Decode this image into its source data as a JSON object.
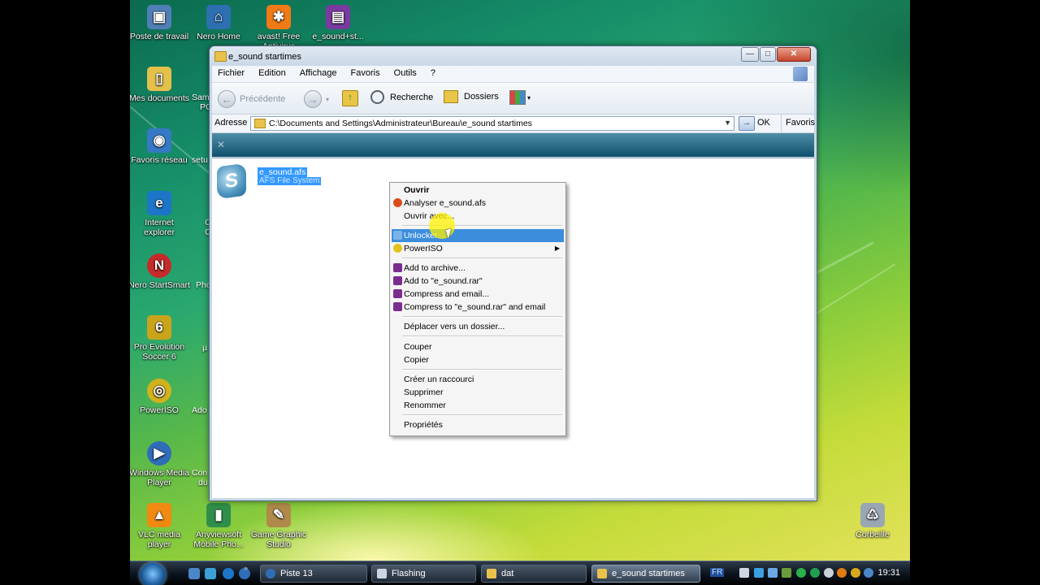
{
  "desktop": {
    "icons": [
      {
        "id": "poste",
        "label": "Poste de travail",
        "glyph": "▣",
        "color": "#4f7fb5"
      },
      {
        "id": "nero",
        "label": "Nero Home",
        "glyph": "⌂",
        "color": "#2d6fb0"
      },
      {
        "id": "avast",
        "label": "avast! Free Antivirus",
        "glyph": "✱",
        "color": "#f07a16"
      },
      {
        "id": "esound",
        "label": "e_sound+st...",
        "glyph": "▤",
        "color": "#7a3aa0"
      },
      {
        "id": "mesdocs",
        "label": "Mes documents",
        "glyph": "▯",
        "color": "#e3c14a"
      },
      {
        "id": "favres",
        "label": "Favoris réseau",
        "glyph": "◉",
        "color": "#3579c4"
      },
      {
        "id": "ie",
        "label": "Internet explorer",
        "glyph": "e",
        "color": "#1d75c8"
      },
      {
        "id": "nerostart",
        "label": "Nero StartSmart",
        "glyph": "N",
        "color": "#c62a2a"
      },
      {
        "id": "pes",
        "label": "Pro Evolution Soccer 6",
        "glyph": "6",
        "color": "#c9a41b"
      },
      {
        "id": "poweriso",
        "label": "PowerISO",
        "glyph": "◎",
        "color": "#d2b21c"
      },
      {
        "id": "wmp",
        "label": "Windows Media Player",
        "glyph": "▶",
        "color": "#2f6db8"
      },
      {
        "id": "vlc",
        "label": "VLC media player",
        "glyph": "▲",
        "color": "#f08a12"
      },
      {
        "id": "anyview",
        "label": "Anyviewsoft Mobile Pho...",
        "glyph": "▮",
        "color": "#2f8f4a"
      },
      {
        "id": "gamegraphic",
        "label": "Game Graphic Studio",
        "glyph": "✎",
        "color": "#b08a4a"
      },
      {
        "id": "corbeille",
        "label": "Corbeille",
        "glyph": "♺",
        "color": "#9aa7b3"
      }
    ],
    "peek": [
      "Sam",
      "PC",
      "setu",
      "C",
      "C",
      "Pho",
      "µ",
      "Ado",
      "Con",
      "du"
    ]
  },
  "window": {
    "title": "e_sound startimes",
    "controls": {
      "min": "—",
      "max": "□",
      "close": "✕"
    },
    "menu": [
      "Fichier",
      "Edition",
      "Affichage",
      "Favoris",
      "Outils",
      "?"
    ],
    "toolbar": {
      "back": "Précédente",
      "search": "Recherche",
      "folders": "Dossiers"
    },
    "address": {
      "label": "Adresse",
      "path": "C:\\Documents and Settings\\Administrateur\\Bureau\\e_sound startimes",
      "go": "OK",
      "favorites": "Favoris"
    },
    "file": {
      "name": "e_sound.afs",
      "type": "AFS File System"
    }
  },
  "context_menu": {
    "items": [
      {
        "label": "Ouvrir",
        "bold": true
      },
      {
        "label": "Analyser e_sound.afs",
        "icon": "#d94c1c"
      },
      {
        "label": "Ouvrir avec..."
      },
      {
        "label": "Unlocker",
        "highlight": true,
        "icon": "#7db3e8"
      },
      {
        "label": "PowerISO",
        "icon": "#e4c21d",
        "submenu": true
      },
      {
        "label": "Add to archive...",
        "icon": "#7b2c8f"
      },
      {
        "label": "Add to \"e_sound.rar\"",
        "icon": "#7b2c8f"
      },
      {
        "label": "Compress and email...",
        "icon": "#7b2c8f"
      },
      {
        "label": "Compress to \"e_sound.rar\" and email",
        "icon": "#7b2c8f"
      },
      {
        "label": "Déplacer vers un dossier..."
      },
      {
        "label": "Couper"
      },
      {
        "label": "Copier"
      },
      {
        "label": "Créer un raccourci"
      },
      {
        "label": "Supprimer"
      },
      {
        "label": "Renommer"
      },
      {
        "label": "Propriétés"
      }
    ]
  },
  "taskbar": {
    "buttons": [
      "Piste 13",
      "Flashing",
      "dat",
      "e_sound startimes"
    ],
    "active": "e_sound startimes",
    "language": "FR",
    "clock": "19:31"
  }
}
